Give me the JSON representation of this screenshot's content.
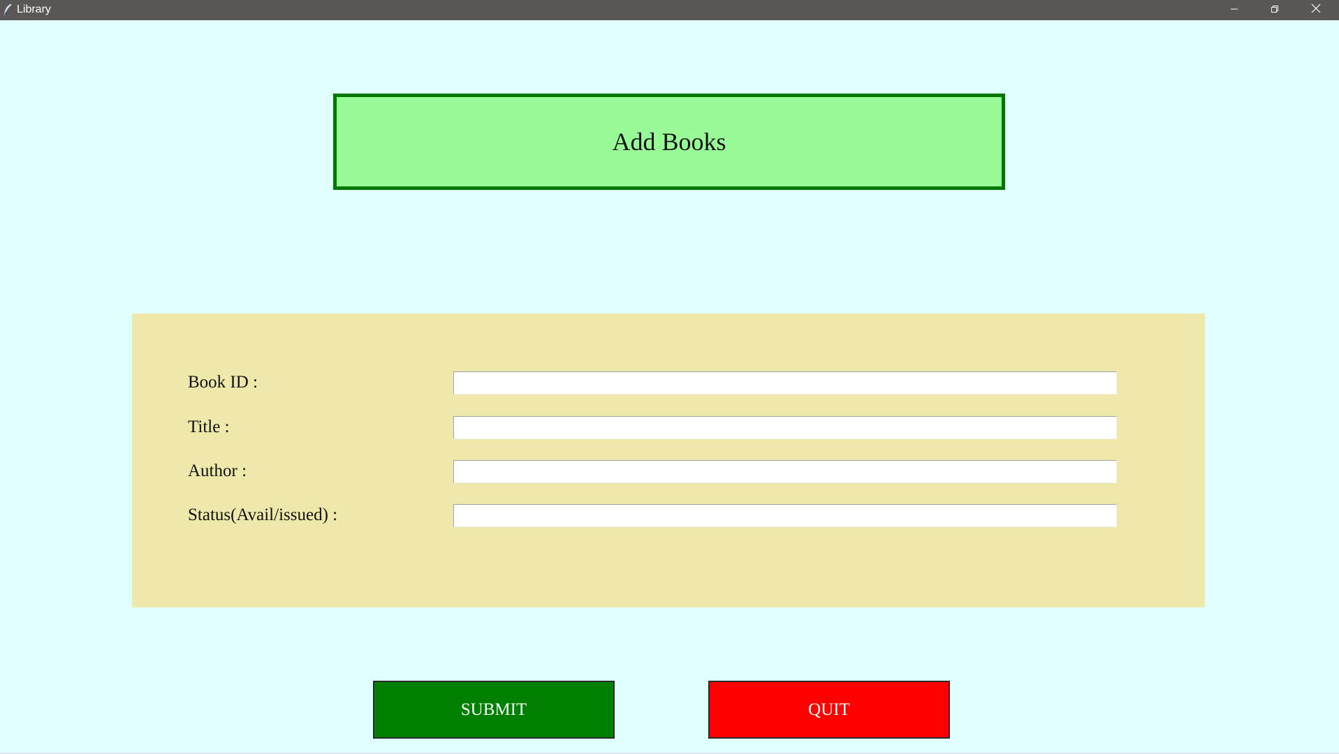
{
  "window": {
    "title": "Library",
    "icons": {
      "app": "feather-icon",
      "minimize": "minimize-icon",
      "maximize": "restore-icon",
      "close": "close-icon"
    }
  },
  "heading": {
    "text": "Add Books",
    "background": "#98fb98",
    "border": "#007800"
  },
  "form": {
    "background": "#eee8aa",
    "fields": [
      {
        "label": "Book ID :",
        "value": ""
      },
      {
        "label": "Title :",
        "value": ""
      },
      {
        "label": "Author :",
        "value": ""
      },
      {
        "label": "Status(Avail/issued) :",
        "value": ""
      }
    ]
  },
  "buttons": {
    "submit": {
      "label": "SUBMIT",
      "color": "#008000"
    },
    "quit": {
      "label": "QUIT",
      "color": "#ff0000"
    }
  },
  "colors": {
    "window_background": "#e0ffff",
    "titlebar": "#5a5856"
  }
}
